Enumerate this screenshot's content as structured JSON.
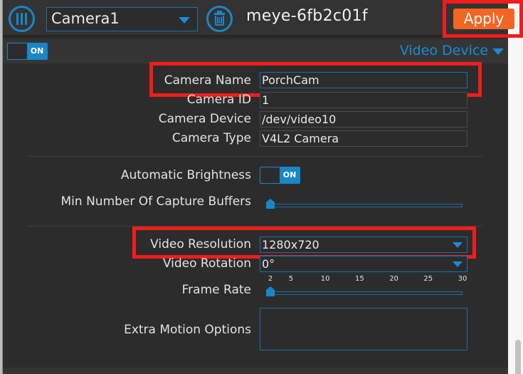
{
  "header": {
    "camera_select_value": "Camera1",
    "device_name": "meye-6fb2c01f",
    "apply_label": "Apply"
  },
  "section": {
    "enabled_toggle_label": "ON",
    "enabled": true,
    "title": "Video Device"
  },
  "fields": {
    "camera_name": {
      "label": "Camera Name",
      "value": "PorchCam"
    },
    "camera_id": {
      "label": "Camera ID",
      "value": "1"
    },
    "camera_device": {
      "label": "Camera Device",
      "value": "/dev/video10"
    },
    "camera_type": {
      "label": "Camera Type",
      "value": "V4L2 Camera"
    },
    "auto_brightness": {
      "label": "Automatic Brightness",
      "toggle_label": "ON",
      "enabled": true
    },
    "min_capture_buffers": {
      "label": "Min Number Of Capture Buffers",
      "slider_fraction": 0
    },
    "video_resolution": {
      "label": "Video Resolution",
      "value": "1280x720"
    },
    "video_rotation": {
      "label": "Video Rotation",
      "value": "0°"
    },
    "frame_rate": {
      "label": "Frame Rate",
      "ticks": [
        "2",
        "5",
        "10",
        "15",
        "20",
        "25",
        "30"
      ],
      "value": 2,
      "min": 2,
      "max": 30
    },
    "extra_motion_options": {
      "label": "Extra Motion Options",
      "value": ""
    }
  },
  "colors": {
    "accent": "#1a86c8",
    "apply": "#f26522",
    "highlight": "#f21c1c",
    "panel_bg": "#2c2c2c"
  }
}
